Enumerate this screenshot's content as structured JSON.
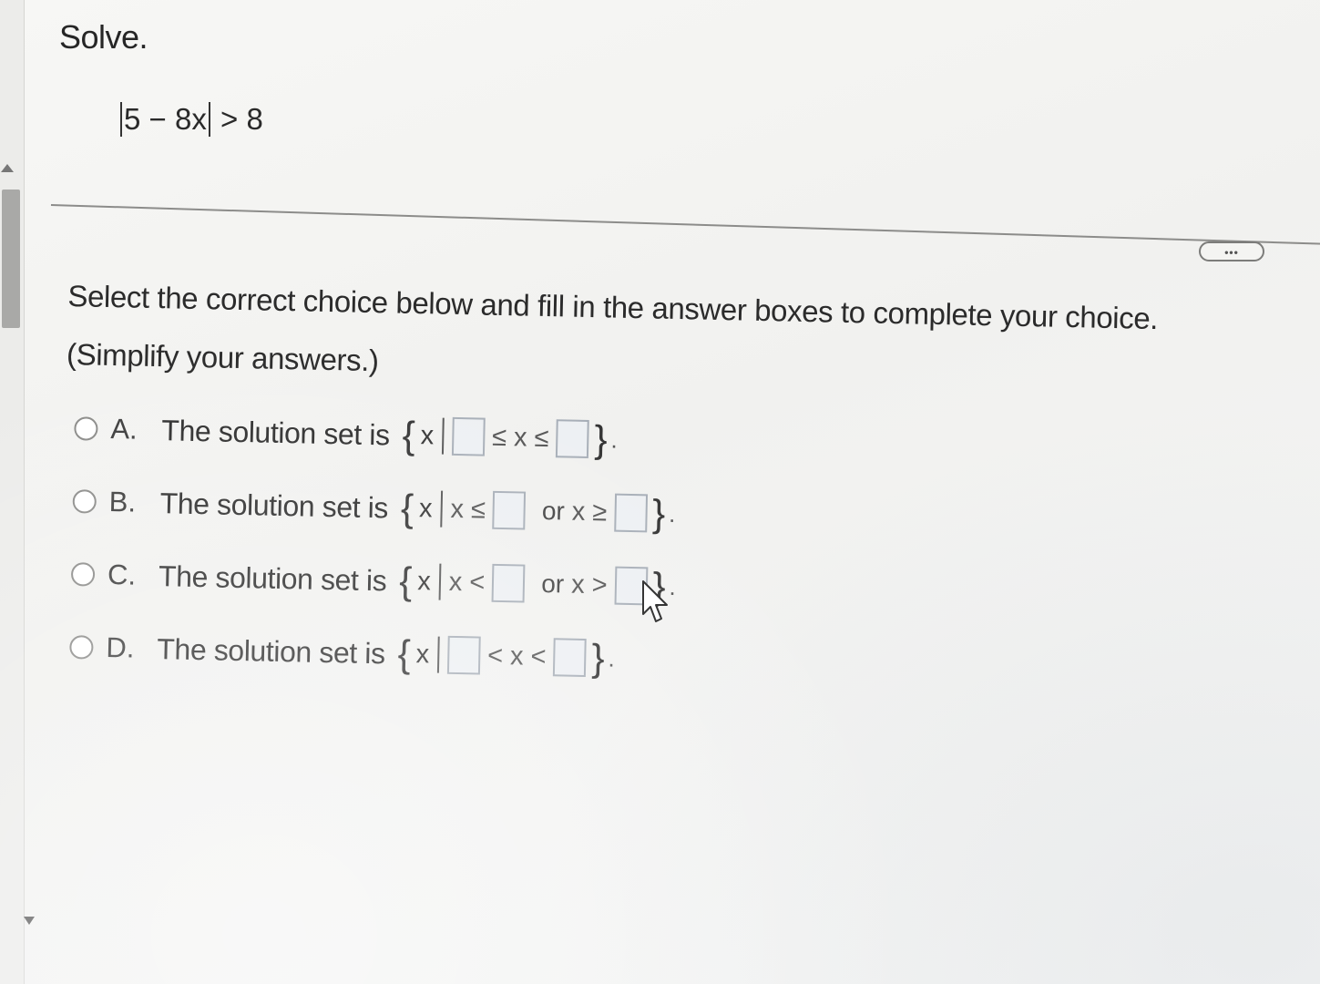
{
  "problem": {
    "title": "Solve.",
    "equation": {
      "inside": "5 − 8x",
      "operator": ">",
      "rhs": "8"
    }
  },
  "toolbar": {
    "more_label": "•••"
  },
  "instructions": {
    "main": "Select the correct choice below and fill in the answer boxes to complete your choice.",
    "note": "(Simplify your answers.)"
  },
  "choices": [
    {
      "letter": "A.",
      "text": "The solution set is",
      "open": "{",
      "var": "x",
      "op1": "≤",
      "mid": "x",
      "op2": "≤",
      "close": "}",
      "period": "."
    },
    {
      "letter": "B.",
      "text": "The solution set is",
      "open": "{",
      "var": "x",
      "lhs": "x",
      "op1": "≤",
      "or": "or",
      "lhs2": "x",
      "op2": "≥",
      "close": "}",
      "period": "."
    },
    {
      "letter": "C.",
      "text": "The solution set is",
      "open": "{",
      "var": "x",
      "lhs": "x",
      "op1": "<",
      "or": "or",
      "lhs2": "x",
      "op2": ">",
      "close": "}",
      "period": "."
    },
    {
      "letter": "D.",
      "text": "The solution set is",
      "open": "{",
      "var": "x",
      "op1": "<",
      "mid": "x",
      "op2": "<",
      "close": "}",
      "period": "."
    }
  ],
  "colors": {
    "box_border": "#a7aeb7",
    "box_fill": "#edf0f3",
    "radio_border": "#8a8a88"
  }
}
